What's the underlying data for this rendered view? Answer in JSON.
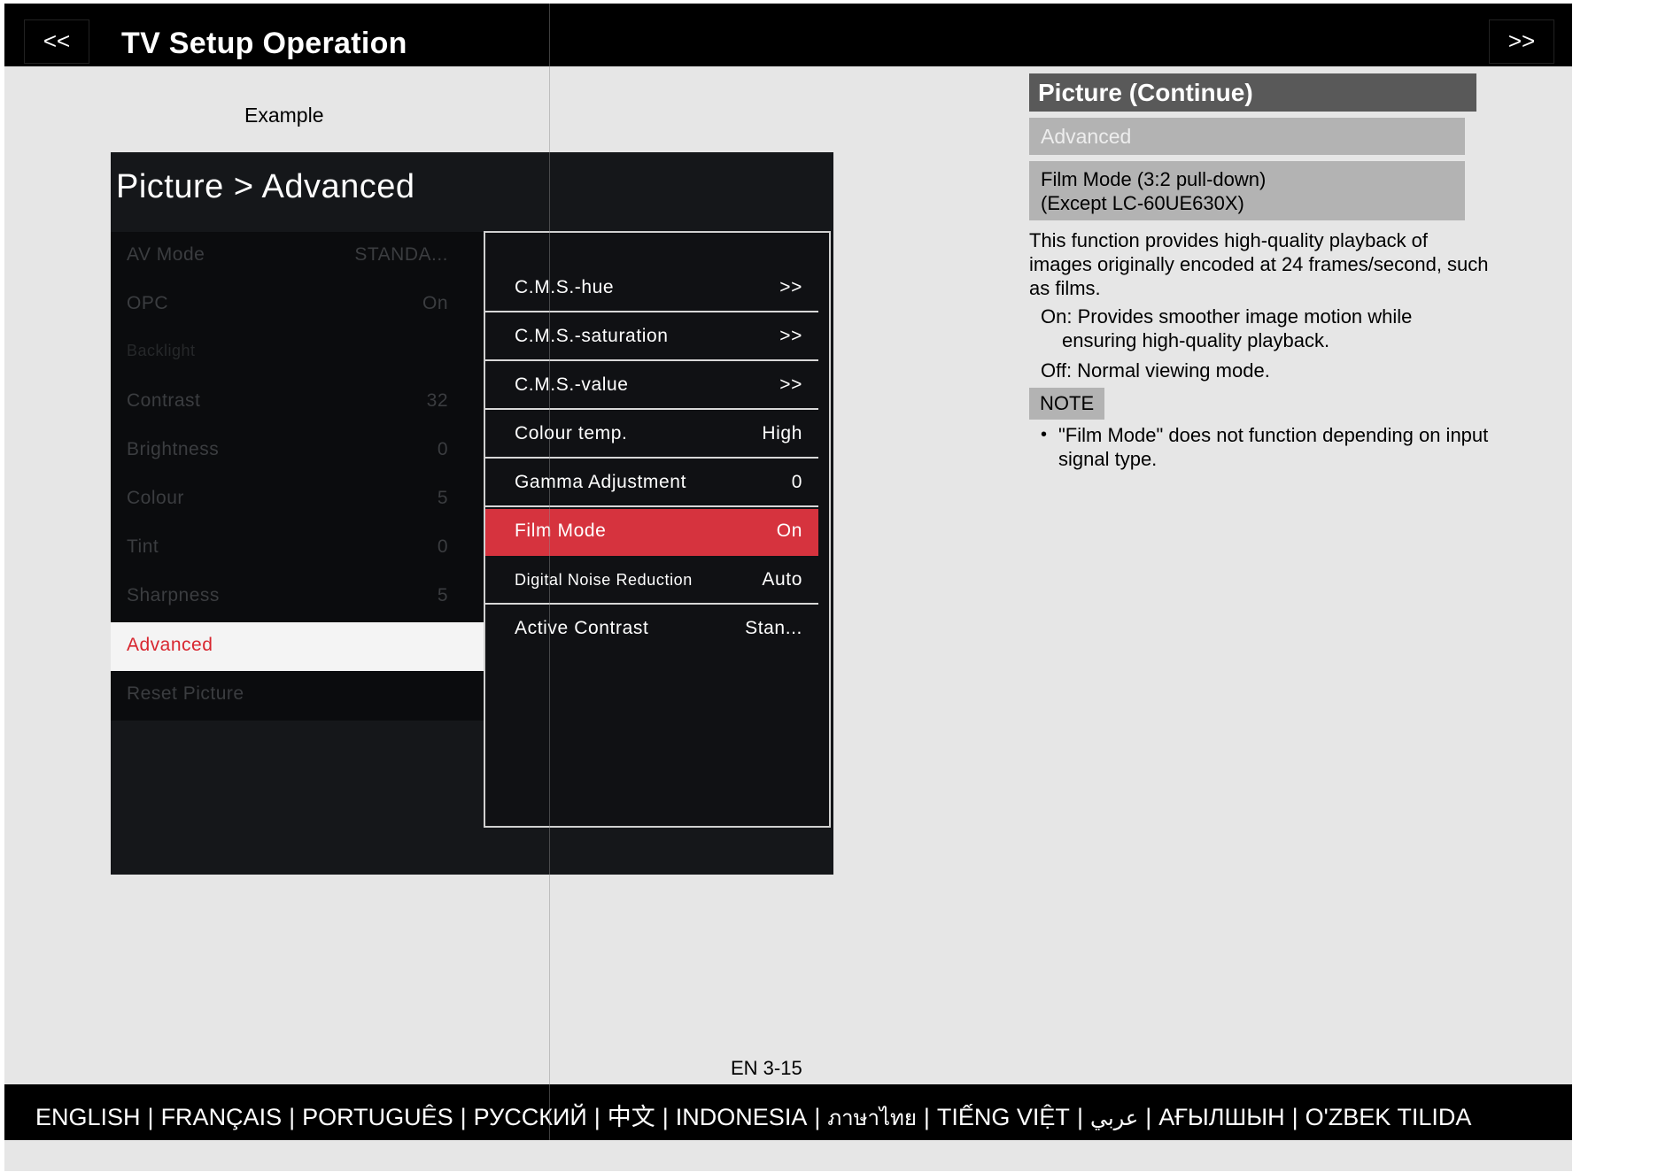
{
  "header": {
    "prev_label": "<<",
    "next_label": ">>",
    "title": "TV Setup Operation"
  },
  "example": {
    "caption": "Example",
    "breadcrumb": "Picture > Advanced",
    "left_menu": [
      {
        "label": "AV Mode",
        "value": "STANDA..."
      },
      {
        "label": "OPC",
        "value": "On"
      },
      {
        "label": "Backlight",
        "value": ""
      },
      {
        "label": "Contrast",
        "value": "32"
      },
      {
        "label": "Brightness",
        "value": "0"
      },
      {
        "label": "Colour",
        "value": "5"
      },
      {
        "label": "Tint",
        "value": "0"
      },
      {
        "label": "Sharpness",
        "value": "5"
      },
      {
        "label": "Advanced",
        "value": ""
      },
      {
        "label": "Reset Picture",
        "value": ""
      }
    ],
    "right_menu": [
      {
        "label": "C.M.S.-hue",
        "value": ">>"
      },
      {
        "label": "C.M.S.-saturation",
        "value": ">>"
      },
      {
        "label": "C.M.S.-value",
        "value": ">>"
      },
      {
        "label": "Colour temp.",
        "value": "High"
      },
      {
        "label": "Gamma Adjustment",
        "value": "0"
      },
      {
        "label": "Film Mode",
        "value": "On"
      },
      {
        "label": "Digital Noise Reduction",
        "value": "Auto"
      },
      {
        "label": "Active Contrast",
        "value": "Stan..."
      }
    ],
    "selected_left": "Advanced",
    "highlight_color": "#d6333e"
  },
  "section": {
    "title": "Picture (Continue)",
    "subtitle": "Advanced",
    "item_title_line1": "Film Mode (3:2 pull-down)",
    "item_title_line2": "(Except LC-60UE630X)",
    "description": "This function provides high-quality playback of images originally encoded at 24 frames/second, such as films.",
    "on_line1": "On: Provides smoother image motion while",
    "on_line2": "ensuring high-quality playback.",
    "off_text": "Off: Normal viewing mode.",
    "note_label": "NOTE",
    "note_bullet": "•",
    "note_text": "\"Film Mode\" does not function depending on input signal type."
  },
  "footer": {
    "page_number": "EN 3-15",
    "separator": "|",
    "languages": [
      "ENGLISH",
      "FRANÇAIS",
      "PORTUGUÊS",
      "РУССКИЙ",
      "中文",
      "INDONESIA",
      "ภาษาไทย",
      "TIẾNG VIỆT",
      "عربي",
      "АҒЫЛШЫН",
      "O'ZBEK TILIDA"
    ]
  }
}
